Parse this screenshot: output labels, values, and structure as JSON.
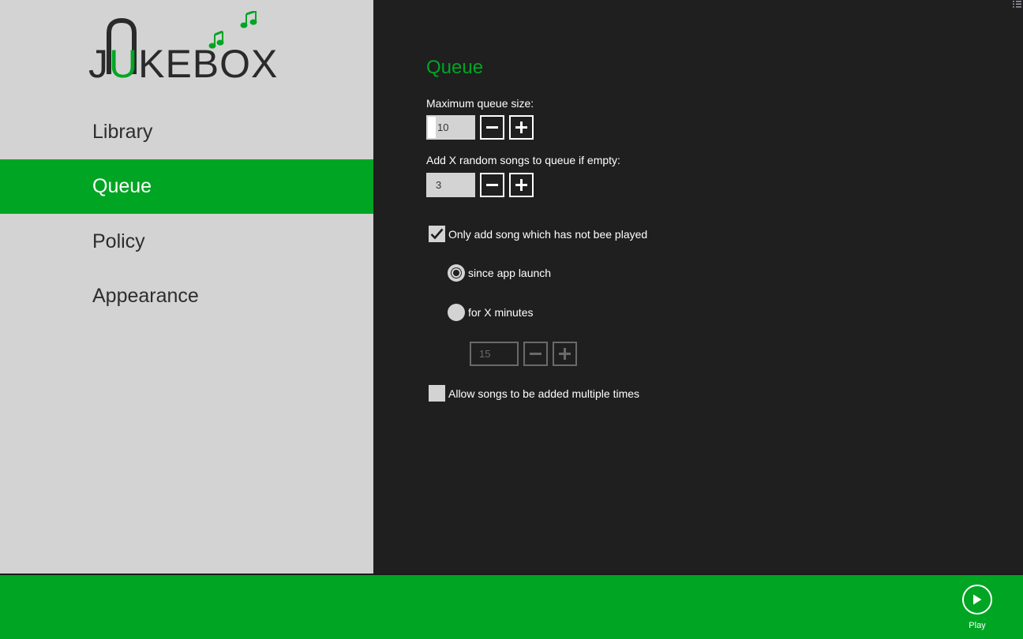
{
  "app": {
    "logo": {
      "prefix": "J",
      "letter_u": "U",
      "suffix": "KEBOX",
      "accent_color": "#00a523"
    }
  },
  "sidebar": {
    "items": [
      {
        "label": "Library",
        "active": false
      },
      {
        "label": "Queue",
        "active": true
      },
      {
        "label": "Policy",
        "active": false
      },
      {
        "label": "Appearance",
        "active": false
      }
    ]
  },
  "main": {
    "section_title": "Queue",
    "max_queue": {
      "label": "Maximum queue size:",
      "value": "10"
    },
    "random_songs": {
      "label": "Add X random songs to queue if empty:",
      "value": "3"
    },
    "only_unplayed": {
      "label": "Only add song which has not bee played",
      "checked": true
    },
    "since_launch": {
      "label": "since app launch",
      "selected": true
    },
    "for_minutes": {
      "label": "for X minutes",
      "selected": false,
      "value": "15",
      "disabled": true
    },
    "allow_multiple": {
      "label": "Allow songs to be added multiple times",
      "checked": false
    }
  },
  "appbar": {
    "play_label": "Play",
    "play_icon": "play-icon"
  },
  "colors": {
    "accent": "#00a523",
    "sidebar_bg": "#d3d3d3",
    "main_bg": "#1f1f1f"
  }
}
